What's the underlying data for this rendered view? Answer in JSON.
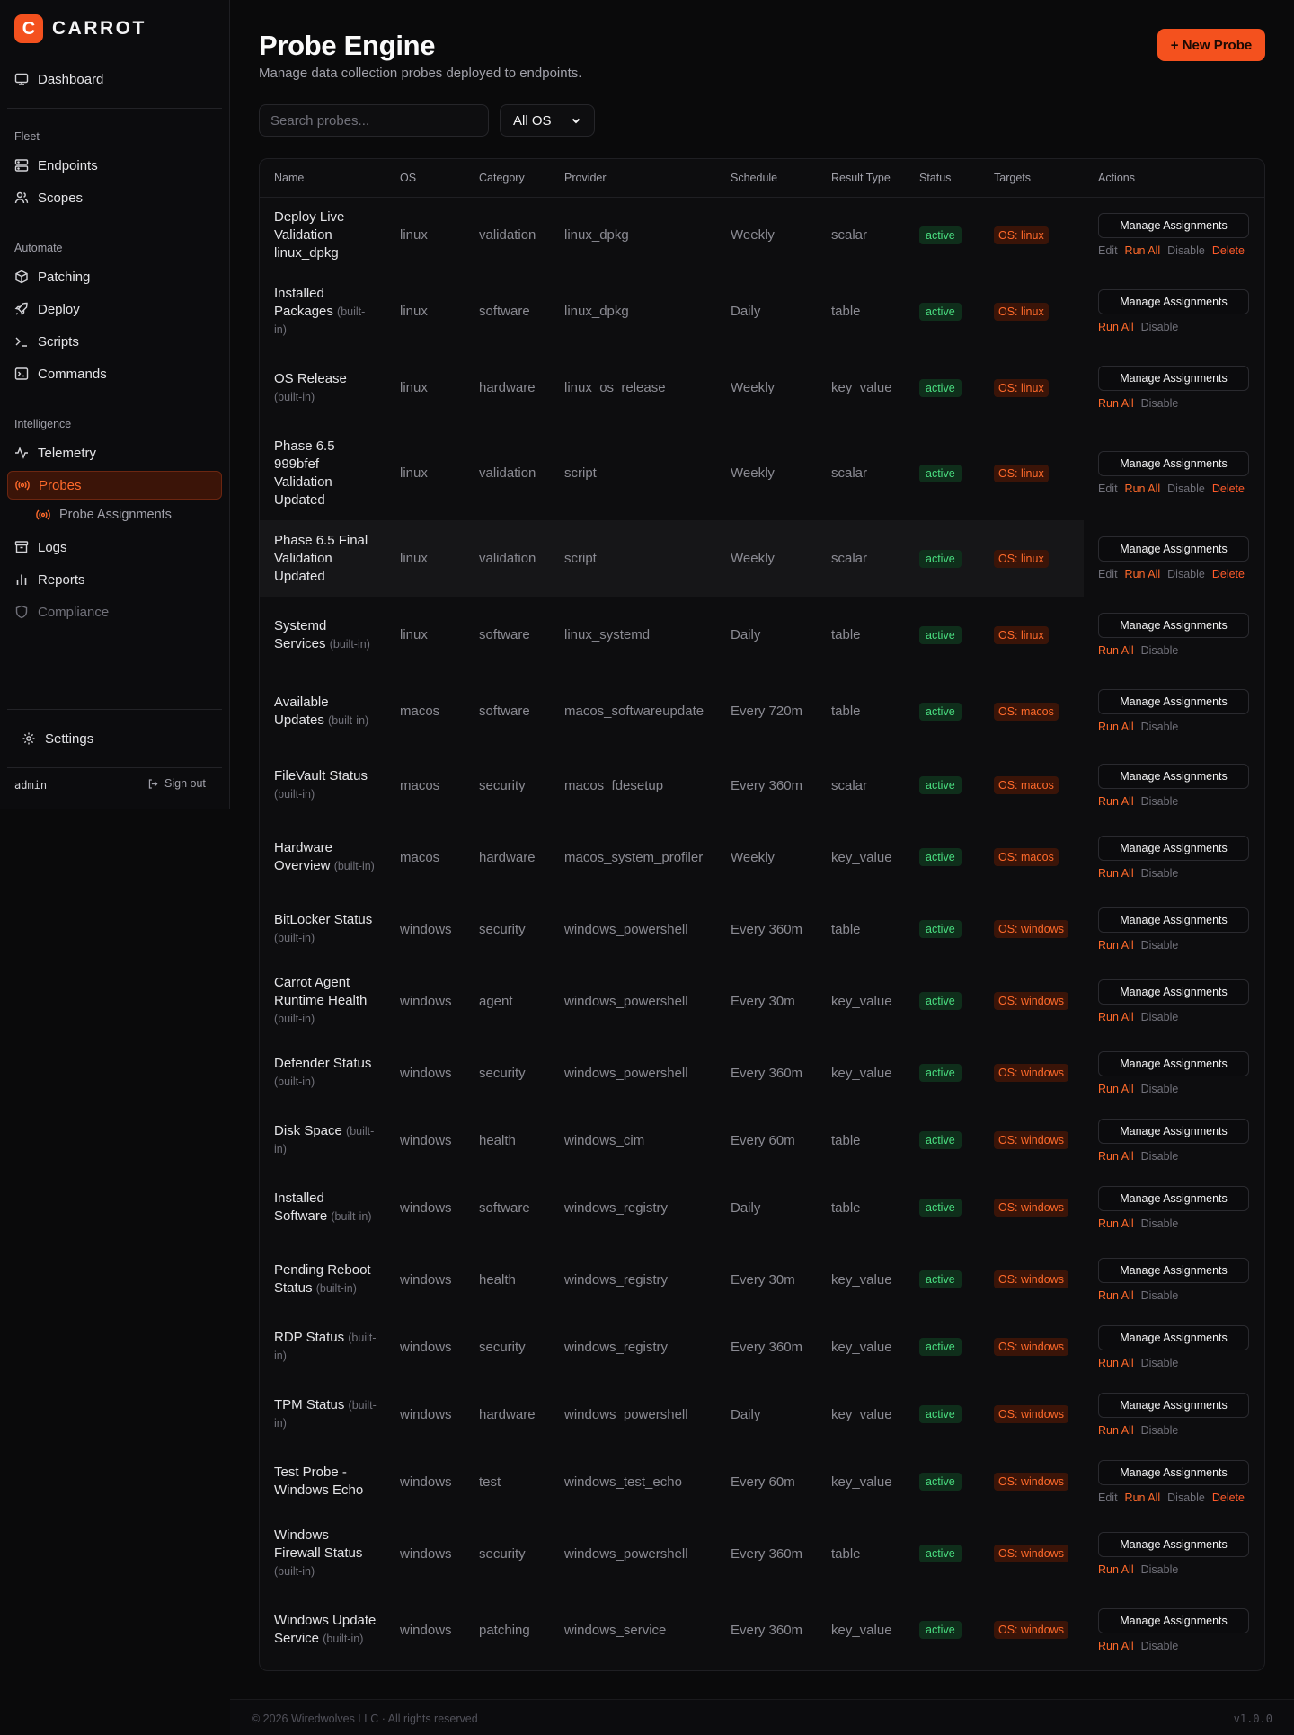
{
  "brand": {
    "logo_letter": "C",
    "name": "CARROT",
    "accent": "#f4511e"
  },
  "sidebar": {
    "dashboard": "Dashboard",
    "sections": {
      "fleet": "Fleet",
      "automate": "Automate",
      "intelligence": "Intelligence"
    },
    "fleet": [
      "Endpoints",
      "Scopes"
    ],
    "automate": [
      "Patching",
      "Deploy",
      "Scripts",
      "Commands"
    ],
    "intelligence": [
      "Telemetry",
      "Probes",
      "Probe Assignments",
      "Logs",
      "Reports",
      "Compliance"
    ],
    "active_item": "Probes",
    "settings": "Settings",
    "user": "admin",
    "sign_out": "Sign out"
  },
  "page": {
    "title": "Probe Engine",
    "subtitle": "Manage data collection probes deployed to endpoints.",
    "new_button": "+ New Probe"
  },
  "filters": {
    "search_placeholder": "Search probes...",
    "os_selected": "All OS"
  },
  "table": {
    "columns": [
      "Name",
      "OS",
      "Category",
      "Provider",
      "Schedule",
      "Result Type",
      "Status",
      "Targets",
      "Actions"
    ],
    "manage_label": "Manage Assignments",
    "edit_label": "Edit",
    "run_label": "Run All",
    "disable_label": "Disable",
    "delete_label": "Delete",
    "builtin_label": "(built-in)",
    "rows": [
      {
        "name": "Deploy Live Validation linux_dpkg",
        "builtin": false,
        "os": "linux",
        "category": "validation",
        "provider": "linux_dpkg",
        "schedule": "Weekly",
        "result_type": "scalar",
        "status": "active",
        "target": "OS: linux"
      },
      {
        "name": "Installed Packages",
        "builtin": true,
        "os": "linux",
        "category": "software",
        "provider": "linux_dpkg",
        "schedule": "Daily",
        "result_type": "table",
        "status": "active",
        "target": "OS: linux"
      },
      {
        "name": "OS Release",
        "builtin": true,
        "os": "linux",
        "category": "hardware",
        "provider": "linux_os_release",
        "schedule": "Weekly",
        "result_type": "key_value",
        "status": "active",
        "target": "OS: linux"
      },
      {
        "name": "Phase 6.5 999bfef Validation Updated",
        "builtin": false,
        "os": "linux",
        "category": "validation",
        "provider": "script",
        "schedule": "Weekly",
        "result_type": "scalar",
        "status": "active",
        "target": "OS: linux"
      },
      {
        "name": "Phase 6.5 Final Validation Updated",
        "builtin": false,
        "os": "linux",
        "category": "validation",
        "provider": "script",
        "schedule": "Weekly",
        "result_type": "scalar",
        "status": "active",
        "target": "OS: linux",
        "highlight": true
      },
      {
        "name": "Systemd Services",
        "builtin": true,
        "os": "linux",
        "category": "software",
        "provider": "linux_systemd",
        "schedule": "Daily",
        "result_type": "table",
        "status": "active",
        "target": "OS: linux"
      },
      {
        "name": "Available Updates",
        "builtin": true,
        "os": "macos",
        "category": "software",
        "provider": "macos_softwareupdate",
        "schedule": "Every 720m",
        "result_type": "table",
        "status": "active",
        "target": "OS: macos"
      },
      {
        "name": "FileVault Status",
        "builtin": true,
        "os": "macos",
        "category": "security",
        "provider": "macos_fdesetup",
        "schedule": "Every 360m",
        "result_type": "scalar",
        "status": "active",
        "target": "OS: macos"
      },
      {
        "name": "Hardware Overview",
        "builtin": true,
        "os": "macos",
        "category": "hardware",
        "provider": "macos_system_profiler",
        "schedule": "Weekly",
        "result_type": "key_value",
        "status": "active",
        "target": "OS: macos"
      },
      {
        "name": "BitLocker Status",
        "builtin": true,
        "os": "windows",
        "category": "security",
        "provider": "windows_powershell",
        "schedule": "Every 360m",
        "result_type": "table",
        "status": "active",
        "target": "OS: windows"
      },
      {
        "name": "Carrot Agent Runtime Health",
        "builtin": true,
        "os": "windows",
        "category": "agent",
        "provider": "windows_powershell",
        "schedule": "Every 30m",
        "result_type": "key_value",
        "status": "active",
        "target": "OS: windows"
      },
      {
        "name": "Defender Status",
        "builtin": true,
        "os": "windows",
        "category": "security",
        "provider": "windows_powershell",
        "schedule": "Every 360m",
        "result_type": "key_value",
        "status": "active",
        "target": "OS: windows"
      },
      {
        "name": "Disk Space",
        "builtin": true,
        "os": "windows",
        "category": "health",
        "provider": "windows_cim",
        "schedule": "Every 60m",
        "result_type": "table",
        "status": "active",
        "target": "OS: windows"
      },
      {
        "name": "Installed Software",
        "builtin": true,
        "os": "windows",
        "category": "software",
        "provider": "windows_registry",
        "schedule": "Daily",
        "result_type": "table",
        "status": "active",
        "target": "OS: windows"
      },
      {
        "name": "Pending Reboot Status",
        "builtin": true,
        "os": "windows",
        "category": "health",
        "provider": "windows_registry",
        "schedule": "Every 30m",
        "result_type": "key_value",
        "status": "active",
        "target": "OS: windows"
      },
      {
        "name": "RDP Status",
        "builtin": true,
        "os": "windows",
        "category": "security",
        "provider": "windows_registry",
        "schedule": "Every 360m",
        "result_type": "key_value",
        "status": "active",
        "target": "OS: windows"
      },
      {
        "name": "TPM Status",
        "builtin": true,
        "os": "windows",
        "category": "hardware",
        "provider": "windows_powershell",
        "schedule": "Daily",
        "result_type": "key_value",
        "status": "active",
        "target": "OS: windows"
      },
      {
        "name": "Test Probe - Windows Echo",
        "builtin": false,
        "os": "windows",
        "category": "test",
        "provider": "windows_test_echo",
        "schedule": "Every 60m",
        "result_type": "key_value",
        "status": "active",
        "target": "OS: windows"
      },
      {
        "name": "Windows Firewall Status",
        "builtin": true,
        "os": "windows",
        "category": "security",
        "provider": "windows_powershell",
        "schedule": "Every 360m",
        "result_type": "table",
        "status": "active",
        "target": "OS: windows"
      },
      {
        "name": "Windows Update Service",
        "builtin": true,
        "os": "windows",
        "category": "patching",
        "provider": "windows_service",
        "schedule": "Every 360m",
        "result_type": "key_value",
        "status": "active",
        "target": "OS: windows"
      }
    ]
  },
  "footer": {
    "copyright": "© 2026 Wiredwolves LLC · All rights reserved",
    "version": "v1.0.0"
  }
}
